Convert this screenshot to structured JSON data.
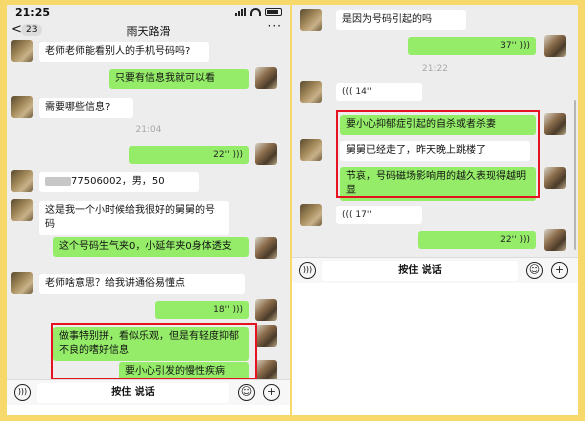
{
  "left": {
    "status": {
      "time": "21:25"
    },
    "header": {
      "back": "<",
      "unread_badge": "23",
      "title": "雨天路滑",
      "more": "···"
    },
    "messages": [
      {
        "from": "them",
        "text": "老师老师能看别人的手机号码吗?"
      },
      {
        "from": "me",
        "text": "只要有信息我就可以看"
      },
      {
        "from": "them",
        "text": "需要哪些信息?"
      },
      {
        "timestamp": "21:04"
      },
      {
        "from": "me",
        "voice": "22''"
      },
      {
        "from": "them",
        "text": "77506002，男，50"
      },
      {
        "from": "them",
        "text": "这是我一个小时候给我很好的舅舅的号码"
      },
      {
        "from": "me",
        "text": "这个号码生气夹0，小延年夹0身体透支"
      },
      {
        "from": "them",
        "text": "老师啥意思？给我讲通俗易懂点"
      },
      {
        "from": "me",
        "voice": "18''"
      },
      {
        "from": "me",
        "text": "做事特别拼，看似乐观，但是有轻度抑郁不良的嗜好信息"
      },
      {
        "from": "me",
        "text": "要小心引发的慢性疾病"
      }
    ],
    "input": {
      "hold_to_talk": "按住 说话",
      "emoji": "☺",
      "plus": "+"
    }
  },
  "right": {
    "messages": [
      {
        "from": "them",
        "text": "是因为号码引起的吗"
      },
      {
        "from": "me",
        "voice": "37''"
      },
      {
        "timestamp": "21:22"
      },
      {
        "from": "them",
        "voice": "14''"
      },
      {
        "from": "me",
        "text": "要小心抑郁症引起的自杀或者杀妻"
      },
      {
        "from": "them",
        "text": "舅舅已经走了，昨天晚上跳楼了"
      },
      {
        "from": "me",
        "text": "节哀，号码磁场影响用的越久表现得越明显"
      },
      {
        "from": "them",
        "voice": "17''"
      },
      {
        "from": "me",
        "voice": "22''"
      }
    ],
    "input": {
      "hold_to_talk": "按住 说话",
      "emoji": "☺",
      "plus": "+"
    }
  },
  "colors": {
    "frame": "#f6d86b",
    "outgoing": "#95ec69",
    "incoming": "#ffffff",
    "highlight": "#e5121f",
    "background": "#ededed"
  }
}
